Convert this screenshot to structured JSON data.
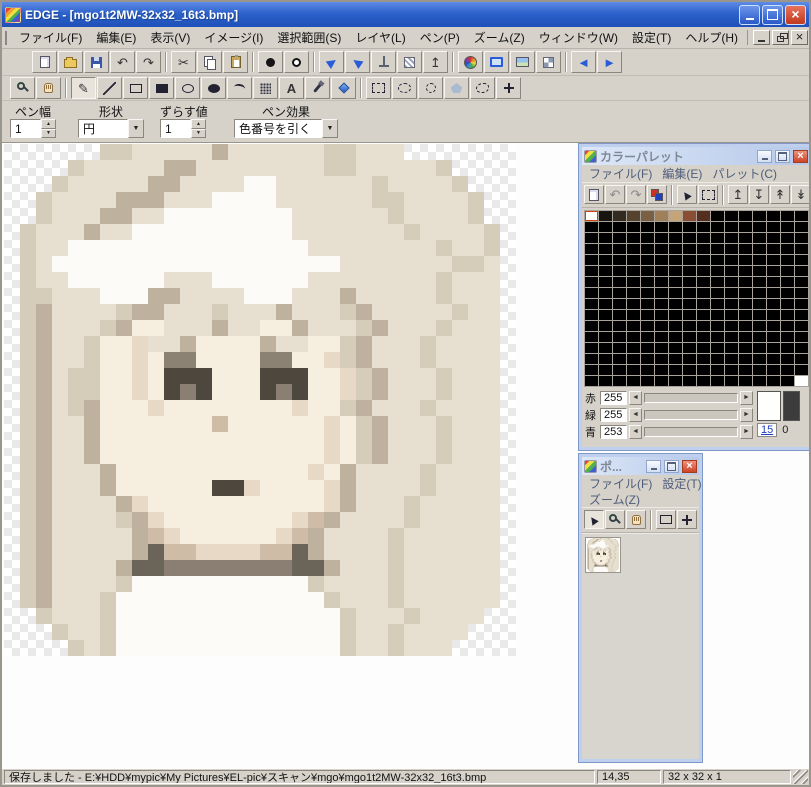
{
  "window": {
    "title": "EDGE - [mgo1t2MW-32x32_16t3.bmp]"
  },
  "menu_bar": {
    "items": [
      {
        "key": "file",
        "label": "ファイル(F)"
      },
      {
        "key": "edit",
        "label": "編集(E)"
      },
      {
        "key": "view",
        "label": "表示(V)"
      },
      {
        "key": "image",
        "label": "イメージ(I)"
      },
      {
        "key": "selection",
        "label": "選択範囲(S)"
      },
      {
        "key": "layer",
        "label": "レイヤ(L)"
      },
      {
        "key": "pen",
        "label": "ペン(P)"
      },
      {
        "key": "zoom",
        "label": "ズーム(Z)"
      },
      {
        "key": "window",
        "label": "ウィンドウ(W)"
      },
      {
        "key": "settings",
        "label": "設定(T)"
      },
      {
        "key": "help",
        "label": "ヘルプ(H)"
      }
    ]
  },
  "toolbar1": {
    "buttons": [
      {
        "name": "new-file",
        "icon": "i-page"
      },
      {
        "name": "open-file",
        "icon": "i-open"
      },
      {
        "name": "save-file",
        "icon": "i-save"
      },
      {
        "name": "undo",
        "icon": "i-glyph",
        "glyph": "↶"
      },
      {
        "name": "redo",
        "icon": "i-glyph",
        "glyph": "↷"
      },
      {
        "sep": true
      },
      {
        "name": "cut",
        "icon": "i-glyph",
        "glyph": "✂"
      },
      {
        "name": "copy",
        "icon": "i-copy"
      },
      {
        "name": "paste",
        "icon": "i-paste"
      },
      {
        "sep": true
      },
      {
        "name": "black-circle",
        "icon": "i-dot"
      },
      {
        "name": "white-circle",
        "icon": "i-ring"
      },
      {
        "sep": true
      },
      {
        "name": "flip-horizontal",
        "icon": "i-plane",
        "glyph": "▶"
      },
      {
        "name": "flip-vertical",
        "icon": "i-plane2",
        "glyph": "▶"
      },
      {
        "name": "measure",
        "icon": "i-measure"
      },
      {
        "name": "pattern",
        "icon": "i-pattern"
      },
      {
        "name": "export",
        "icon": "i-glyph",
        "glyph": "↥"
      },
      {
        "sep": true
      },
      {
        "name": "color-palette",
        "icon": "i-palette"
      },
      {
        "name": "preview-monitor",
        "icon": "i-monitor"
      },
      {
        "name": "preview-image",
        "icon": "i-photo"
      },
      {
        "name": "tile-view",
        "icon": "i-tile"
      },
      {
        "sep": true
      },
      {
        "name": "prev-frame",
        "icon": "i-glyph i-blue",
        "glyph": "◄"
      },
      {
        "name": "next-frame",
        "icon": "i-glyph i-blue",
        "glyph": "►"
      }
    ]
  },
  "toolbar2": {
    "buttons": [
      {
        "name": "zoom-tool",
        "icon": "i-zoom"
      },
      {
        "name": "hand-tool",
        "icon": "i-hand"
      },
      {
        "sep": true
      },
      {
        "name": "pencil-tool",
        "icon": "i-glyph",
        "glyph": "✎",
        "pressed": true
      },
      {
        "name": "line-tool",
        "icon": "i-line"
      },
      {
        "name": "rect-tool",
        "icon": "i-rect"
      },
      {
        "name": "filled-rect-tool",
        "icon": "i-rectf"
      },
      {
        "name": "ellipse-tool",
        "icon": "i-ell"
      },
      {
        "name": "filled-ellipse-tool",
        "icon": "i-ellf"
      },
      {
        "name": "curve-tool",
        "icon": "i-curve"
      },
      {
        "name": "spray-tool",
        "icon": "i-spray"
      },
      {
        "name": "text-tool",
        "icon": "i-glyph i-bold",
        "glyph": "A"
      },
      {
        "name": "eyedropper-tool",
        "icon": "i-dropper"
      },
      {
        "name": "fill-tool",
        "icon": "i-diamond"
      },
      {
        "sep": true
      },
      {
        "name": "select-rect-tool",
        "icon": "i-selr"
      },
      {
        "name": "select-ellipse-tool",
        "icon": "i-sele"
      },
      {
        "name": "select-circle-tool",
        "icon": "i-selc"
      },
      {
        "name": "select-polygon-tool",
        "icon": "i-selp"
      },
      {
        "name": "select-freehand-tool",
        "icon": "i-self"
      },
      {
        "name": "select-magic-tool",
        "icon": "i-selm"
      }
    ]
  },
  "pen_controls": {
    "pen_width_label": "ペン幅",
    "pen_width_value": "1",
    "shape_label": "形状",
    "shape_value": "円",
    "shift_label": "ずらす値",
    "shift_value": "1",
    "effect_label": "ペン効果",
    "effect_value": "色番号を引く"
  },
  "pixel_art": {
    "width": 32,
    "height": 32,
    "zoom": 16,
    "palette": {
      ".": null,
      "W": "#fcfbf7",
      "L": "#e7dfd0",
      "M": "#d5ccba",
      "N": "#beb29e",
      "D": "#8c8274",
      "K": "#6b6458",
      "S": "#f6eede",
      "T": "#e8d9c6",
      "U": "#cfbca6",
      "E": "#4e473e",
      "G": "#8a7f72"
    },
    "rows": [
      "......MMLLLLLNLLLLLLMMLLL.......",
      "....MLLLLLNNLLLLLLLLMMLLLLLM....",
      "...MLLLLLNNLLLLWWLLLLLLMLLLLM...",
      "..MLLLLNNNLLLWWWWLLLLLLMMLLLLM..",
      "..MLLLNNLLWWWWWWWWLLLLLLMLLLLM..",
      ".MLLLNLLWWWWWWWWWWLLLLLLLMLLLLM.",
      ".MLLWWWWWWWWWWWWWWWLLLLLLLLMLLM.",
      ".MLWWWWWWWWWWWWWWWWWWLLLLLLLMML.",
      ".MLLWWWWWWLLLWWWWWWLLLLLLLLMLLL.",
      ".MMLLLWWWNNLLLLWWWLLLNLLLLLMLLL.",
      ".MNLLLLMNNLLLMLLLNLLLMNLLLLLMLL.",
      ".MNLLLMNSSLLLNLLSSNLLLMNLLLMLLL.",
      ".MNLLMSSTLLNSSSSNLLSSMNLLLMLLLL.",
      ".MNLLMSSTSDDSSSSDDSSTMNLLLMLLLL.",
      ".MNLMMSSTSEEESSSEEESSTMNLLLMLLL.",
      ".MNLMMSSTSEGESSSEGESSTMNLLLMLLL.",
      ".MNLMNSSSTSSSSSSSSTSSMNLLLMLLLL.",
      ".MNLLNSSSSSSSUSSSSSSTSMNLLLMLLL.",
      ".MNLLNSSSSSSSSSSSSSSTSMNLLLMLLL.",
      ".MNLLNSSSSSSSSSSSSSSTSMNLLLMLLL.",
      ".MNLLLNSSSSSSSSSSSSTSNLLLLMLLLL.",
      ".MNLLLNSSSSSSEETSSSSTNLLLLMLLLL.",
      ".MNLLLLNTSSSSSSSSSSSTNLLLMLLLLL.",
      ".MNLLLLMNTSSSSSSSSTUNLLLLMLLLLL.",
      ".MNLLLLLNUTSSSSSSTUNLLLLMLLLLLL.",
      ".MNLLLLLNKUUTTTTUUKNLLLLMLLLLLL.",
      ".MNLLLLNKKGGGGGGGGKKNLLLMLLLLLL.",
      ".MNLLLLMWWWWWWWWWWWMLLLLMLLLLLL.",
      ".MNLLLMWWWWWWWWWWWWWMLLLMLLLLLL.",
      "..MLLLMWWWWWWWWWWWWWWMLLLMLLLL..",
      "...MLLMWWWWWWWWWWWWWWMLLMLLLL...",
      "....MLMWWWWWWWWWWWWWWMLLMLLL...."
    ]
  },
  "palette_window": {
    "title": "カラーパレット",
    "menu": [
      "ファイル(F)",
      "編集(E)",
      "パレット(C)"
    ],
    "toolbar": [
      {
        "name": "new-palette",
        "icon": "i-page"
      },
      {
        "name": "undo-palette",
        "icon": "i-glyph i-gray",
        "glyph": "↶"
      },
      {
        "name": "redo-palette",
        "icon": "i-glyph i-gray",
        "glyph": "↷"
      },
      {
        "name": "default-colors",
        "icon": "i-defcol"
      },
      {
        "sep": true
      },
      {
        "name": "select-color",
        "icon": "i-cursor-g",
        "glyph": "▶"
      },
      {
        "name": "select-range",
        "icon": "i-selr"
      },
      {
        "sep": true
      },
      {
        "name": "shift-up",
        "icon": "i-glyph",
        "glyph": "↥"
      },
      {
        "name": "shift-down",
        "icon": "i-glyph",
        "glyph": "↧"
      },
      {
        "name": "insert-color",
        "icon": "i-glyph",
        "glyph": "↟"
      },
      {
        "name": "delete-color",
        "icon": "i-glyph",
        "glyph": "↡"
      }
    ],
    "grid": {
      "cols": 16,
      "rows": 16,
      "selected_cell": 0,
      "default": "#000000",
      "last_cell": "#ffffff",
      "row0": [
        "#fcfcfa",
        "#181410",
        "#332a22",
        "#55432f",
        "#7a5f44",
        "#a08058",
        "#c4a478",
        "#8a4e34",
        "#542e1e",
        "#000000",
        "#000000",
        "#000000",
        "#000000",
        "#000000",
        "#000000",
        "#000000"
      ]
    },
    "rgb": [
      {
        "key": "r",
        "label": "赤",
        "value": "255"
      },
      {
        "key": "g",
        "label": "緑",
        "value": "255"
      },
      {
        "key": "b",
        "label": "青",
        "value": "253"
      }
    ],
    "fg_color": "#fffffd",
    "bg_color": "#3c3c3c",
    "fg_index": "15",
    "bg_index": "0"
  },
  "preview_window": {
    "title": "ポ...",
    "menu_line1": [
      "ファイル(F)",
      "設定(T)"
    ],
    "menu_line2": [
      "ズーム(Z)"
    ],
    "toolbar": [
      {
        "name": "pointer-tool",
        "icon": "i-cursor-g",
        "glyph": "▶",
        "pressed": true
      },
      {
        "name": "preview-zoom-tool",
        "icon": "i-zoom"
      },
      {
        "name": "preview-hand-tool",
        "icon": "i-hand"
      },
      {
        "sep": true
      },
      {
        "name": "frame-rect-tool",
        "icon": "i-rect"
      },
      {
        "name": "crosshair-tool",
        "icon": "i-selm"
      }
    ]
  },
  "status_bar": {
    "message": "保存しました - E:¥HDD¥mypic¥My Pictures¥EL-pic¥スキャン¥mgo¥mgo1t2MW-32x32_16t3.bmp",
    "coords": "14,35",
    "size": "32 x 32 x 1"
  }
}
